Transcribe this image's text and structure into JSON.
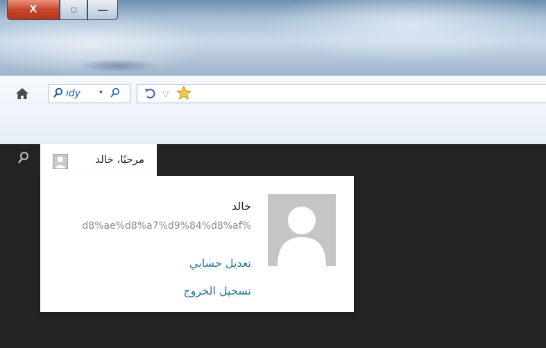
{
  "window": {
    "close_glyph": "X",
    "maximize_glyph": "□",
    "minimize_glyph": "—"
  },
  "toolbar": {
    "home_icon": "home-icon",
    "search_engine_text": "ıdy",
    "search_dropdown_glyph": "▾",
    "undo_icon": "undo-icon",
    "url_dropdown_glyph": "▽",
    "favorite_icon": "star-icon"
  },
  "adminbar": {
    "search_icon": "search-icon",
    "greeting": "مرحبًا، خالد"
  },
  "account_panel": {
    "display_name": "خالد",
    "slug": "d8%ae%d8%a7%d9%84%d8%af%",
    "edit_profile_label": "تعديل حسابي",
    "logout_label": "تسجيل الخروج"
  },
  "colors": {
    "adminbar_bg": "#232323",
    "link": "#21759b",
    "favorite_star": "#f1b92e"
  }
}
